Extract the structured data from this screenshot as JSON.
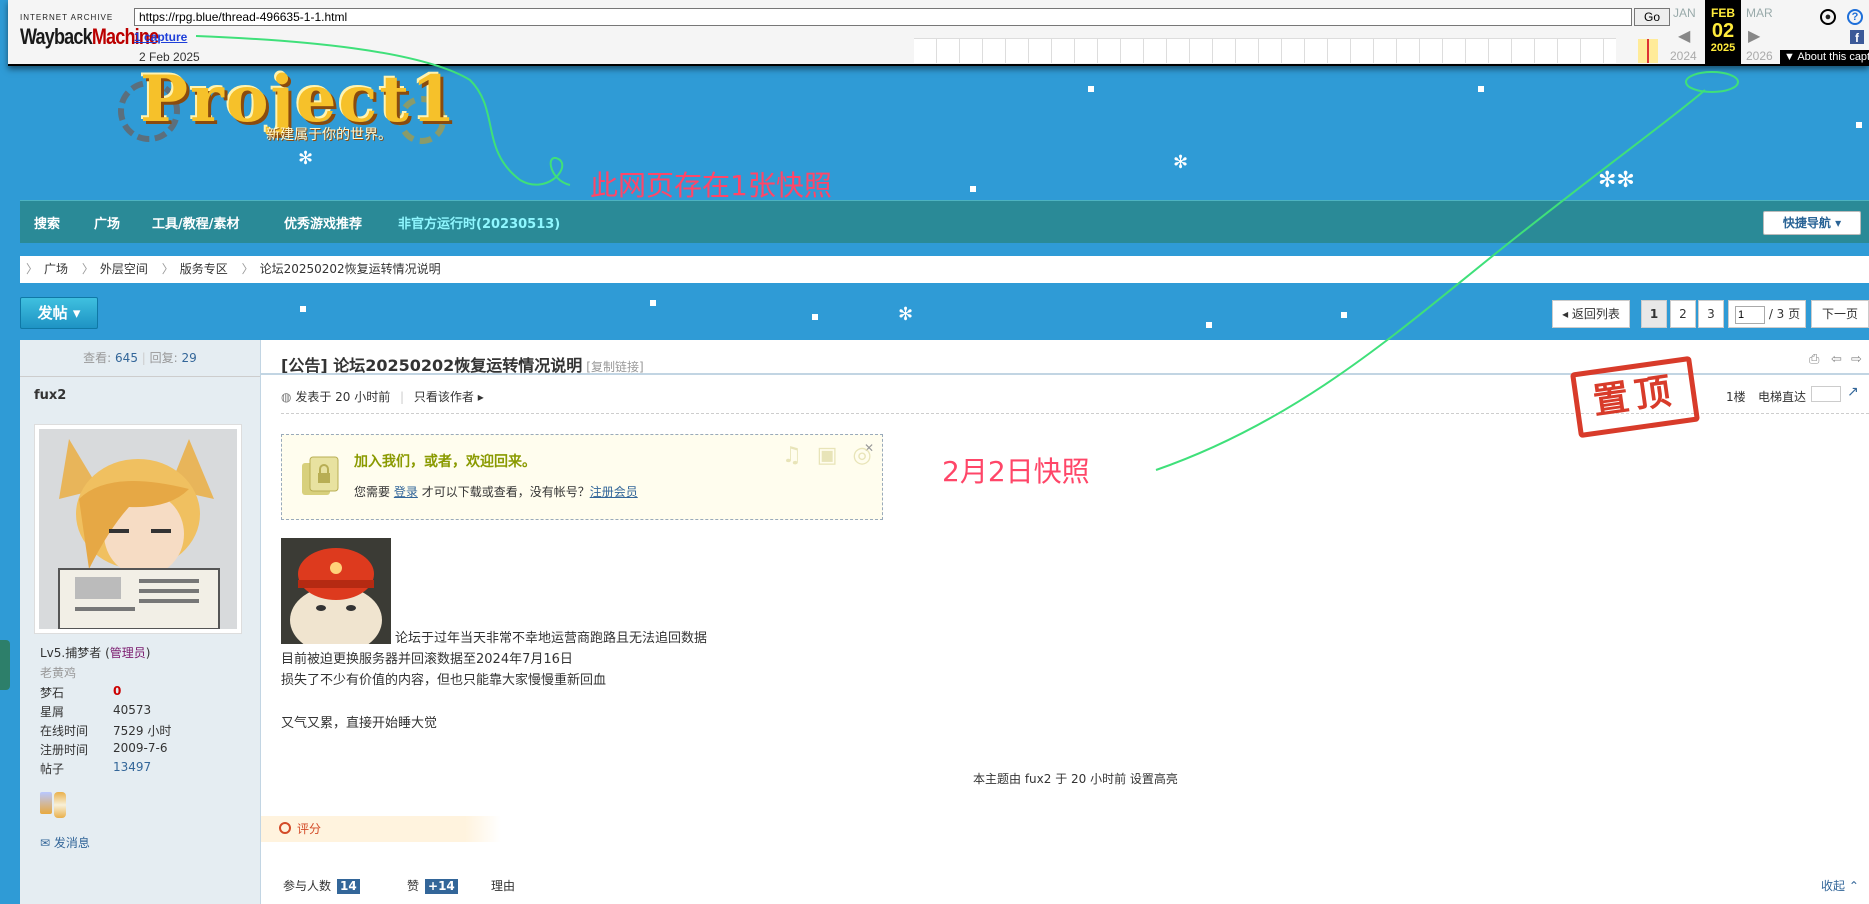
{
  "wayback": {
    "logo_top": "INTERNET ARCHIVE",
    "logo_main_a": "Wayback",
    "logo_main_b": "Machine",
    "url": "https://rpg.blue/thread-496635-1-1.html",
    "go_label": "Go",
    "captures": "1 capture",
    "capture_date": "2 Feb 2025",
    "prev_month": "JAN",
    "cur_month": "FEB",
    "next_month": "MAR",
    "cur_day": "02",
    "prev_year": "2024",
    "cur_year": "2025",
    "next_year": "2026",
    "about": "▼ About this capture"
  },
  "banner": {
    "logo": "Project1",
    "slogan": "新建属于你的世界。"
  },
  "nav": {
    "items": [
      "搜索",
      "广场",
      "工具/教程/素材",
      "优秀游戏推荐",
      "非官方运行时(20230513)"
    ],
    "quick": "快捷导航"
  },
  "breadcrumb": [
    "广场",
    "外层空间",
    "版务专区",
    "论坛20250202恢复运转情况说明"
  ],
  "post_button": "发帖",
  "pager": {
    "back": "返回列表",
    "pages": [
      "1",
      "2",
      "3"
    ],
    "input": "1",
    "total": "/ 3 页",
    "next": "下一页"
  },
  "sidebar": {
    "views_label": "查看:",
    "views": "645",
    "replies_label": "回复:",
    "replies": "29",
    "username": "fux2",
    "level": "Lv5.捕梦者",
    "role": "管理员",
    "title": "老黄鸡",
    "stats": [
      {
        "k": "梦石",
        "v": "0"
      },
      {
        "k": "星屑",
        "v": "40573"
      },
      {
        "k": "在线时间",
        "v": "7529 小时"
      },
      {
        "k": "注册时间",
        "v": "2009-7-6"
      },
      {
        "k": "帖子",
        "v": "13497"
      }
    ],
    "send_msg": "发消息"
  },
  "post": {
    "title": "[公告] 论坛20250202恢复运转情况说明",
    "copy_link": "[复制链接]",
    "posted": "发表于 20 小时前",
    "only_author": "只看该作者",
    "floor": "1楼",
    "jump": "电梯直达",
    "locked_title": "加入我们，或者，欢迎回来。",
    "locked_pre": "您需要",
    "locked_login": "登录",
    "locked_mid": "才可以下载或查看，没有帐号？",
    "locked_reg": "注册会员",
    "lines": [
      "论坛于过年当天非常不幸地运营商跑路且无法追回数据",
      "目前被迫更换服务器并回滚数据至2024年7月16日",
      "损失了不少有价值的内容，但也只能靠大家慢慢重新回血",
      "又气又累，直接开始睡大觉"
    ],
    "highlight_note": "本主题由 fux2 于 20 小时前 设置高亮",
    "stamp": "置顶",
    "rate_label": "评分",
    "participants_label": "参与人数",
    "participants": "14",
    "like_label": "赞",
    "like": "+14",
    "reason_label": "理由",
    "collapse": "收起"
  },
  "annotations": {
    "captures_note": "此网页存在1张快照",
    "snapshot_note": "2月2日快照"
  },
  "colors": {
    "bg": "#2f9bd6",
    "nav": "#2a8a97",
    "annotation": "#ff4668",
    "stroke": "#3fe07a"
  }
}
